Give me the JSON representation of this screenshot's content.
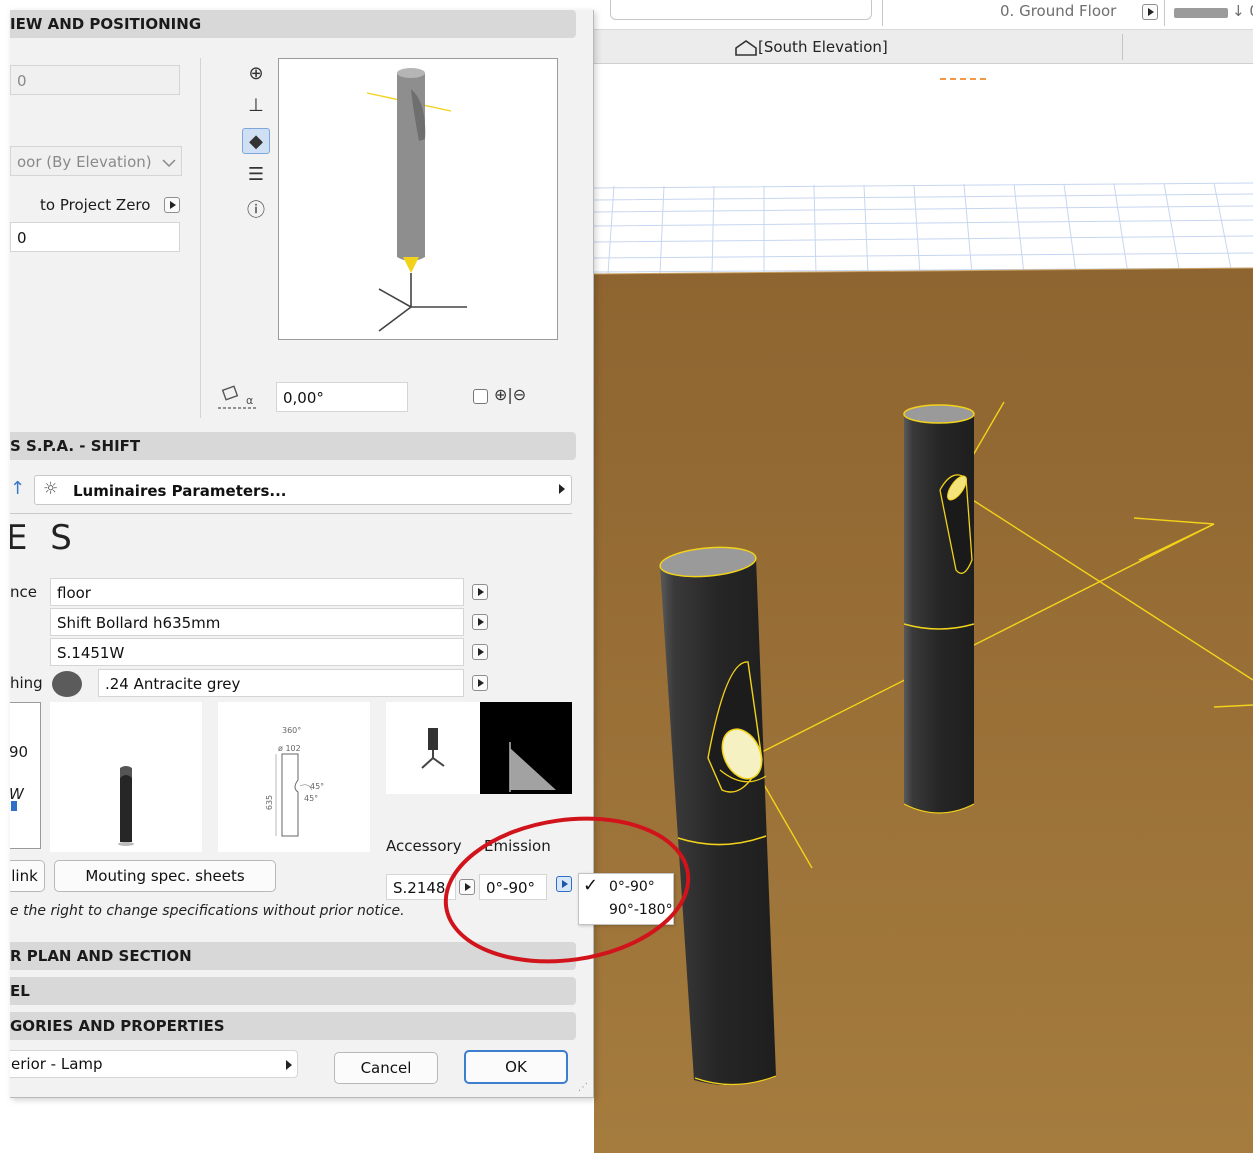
{
  "viewport": {
    "story_label": "0. Ground Floor",
    "tab_label": "[South Elevation]",
    "colors": {
      "ground": "#9a6e34",
      "grid": "#c8d8f2",
      "bollard": "#2b2b2b",
      "highlight": "#f2d21a"
    }
  },
  "dialog": {
    "sections": {
      "view": "IEW AND POSITIONING",
      "shift": "S S.P.A. - SHIFT",
      "plan": "R PLAN AND SECTION",
      "model": "EL",
      "categories": "GORIES AND PROPERTIES"
    },
    "positioning": {
      "offset_value": "0",
      "elevation_ref": "oor (By Elevation)",
      "to_project_zero_label": "to Project Zero",
      "project_zero_value": "0",
      "rotation_value": "0,00°"
    },
    "params_button_label": "Luminaires Parameters...",
    "big_label": "E S",
    "params": [
      {
        "label": "nce",
        "value": "floor"
      },
      {
        "label": "",
        "value": "Shift Bollard h635mm"
      },
      {
        "label": "",
        "value": "S.1451W"
      },
      {
        "label": "hing",
        "value": ".24 Antracite grey"
      }
    ],
    "card_text": {
      "line1": "90",
      "line2": "W"
    },
    "drawing_labels": {
      "angle": "360°",
      "diameter": "ø 102",
      "height": "635",
      "tilt_a": "45°",
      "tilt_b": "45°"
    },
    "accessory_label": "Accessory",
    "emission_label": "Emission",
    "accessory_value": "S.2148",
    "emission_value": "0°-90°",
    "link_button": "link",
    "mounting_button": "Mouting spec. sheets",
    "notice": "e the right to change specifications without prior notice.",
    "layer_value": "erior - Lamp",
    "cancel_label": "Cancel",
    "ok_label": "OK"
  },
  "emission_dropdown": {
    "options": [
      {
        "label": "0°-90°",
        "checked": true
      },
      {
        "label": "90°-180°",
        "checked": false
      }
    ]
  },
  "annotation": {
    "color": "#d1141c"
  }
}
